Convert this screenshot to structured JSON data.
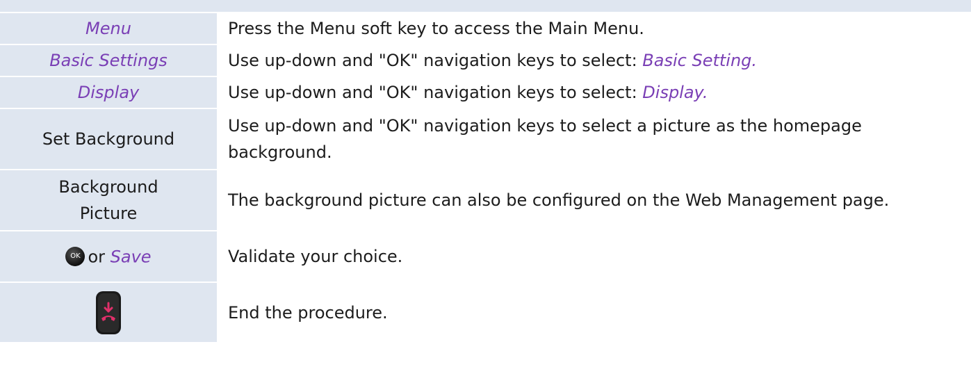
{
  "rows": [
    {
      "step": "Menu",
      "desc": "Press the Menu soft key to access the Main Menu."
    },
    {
      "step": "Basic Settings",
      "desc_prefix": "Use up-down and \"OK\" navigation keys to select: ",
      "desc_term": "Basic Setting."
    },
    {
      "step": "Display",
      "desc_prefix": "Use up-down and \"OK\" navigation keys to select: ",
      "desc_term": "Display."
    },
    {
      "step": "Set Background",
      "desc": "Use up-down and \"OK\" navigation keys to select a picture as the homepage background."
    },
    {
      "step_line1": "Background",
      "step_line2": "Picture",
      "desc": "The background picture can also be configured on the Web Management page."
    },
    {
      "key_label": "OK",
      "or": "or",
      "step": "Save",
      "desc": "Validate your choice."
    },
    {
      "key_icon": "hang-up-key-icon",
      "desc": "End the procedure."
    }
  ],
  "colors": {
    "step_cell_bg": "#dfe6f0",
    "menu_term": "#7a3fb5",
    "hangup_red": "#e0306a"
  }
}
